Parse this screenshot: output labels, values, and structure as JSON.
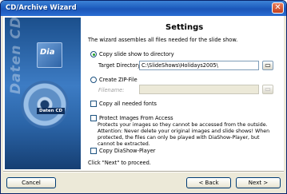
{
  "window": {
    "title": "CD/Archive Wizard",
    "close_glyph": "✕"
  },
  "sidebar": {
    "vertical_text": "Daten CD",
    "tile_text": "Dia",
    "disc_label": "Daten CD",
    "icon": "disc-icon"
  },
  "settings": {
    "heading": "Settings",
    "description": "The wizard assembles all files needed for the slide show.",
    "copy_slideshow": {
      "label": "Copy slide show to directory",
      "checked": true
    },
    "target_directory": {
      "label": "Target Directory:",
      "value": "C:\\SlideShows\\Holidays2005\\"
    },
    "create_zip": {
      "label": "Create ZIP-File",
      "checked": false
    },
    "filename": {
      "label": "Filename:",
      "value": ""
    },
    "copy_fonts": {
      "label": "Copy all needed fonts",
      "checked": false
    },
    "protect_images": {
      "label": "Protect Images From Access",
      "checked": false,
      "note": "Protects your images so they cannot be accessed from the outside. Attention: Never delete your original images and slide shows! When protected, the files can only be played with DiaShow-Player, but cannot be extracted."
    },
    "copy_player": {
      "label": "Copy DiaShow-Player",
      "checked": false
    },
    "proceed_text": "Click \"Next\" to proceed."
  },
  "buttons": {
    "cancel": "Cancel",
    "back": "< Back",
    "next": "Next >"
  },
  "icons": {
    "browse": "folder-open-icon"
  }
}
